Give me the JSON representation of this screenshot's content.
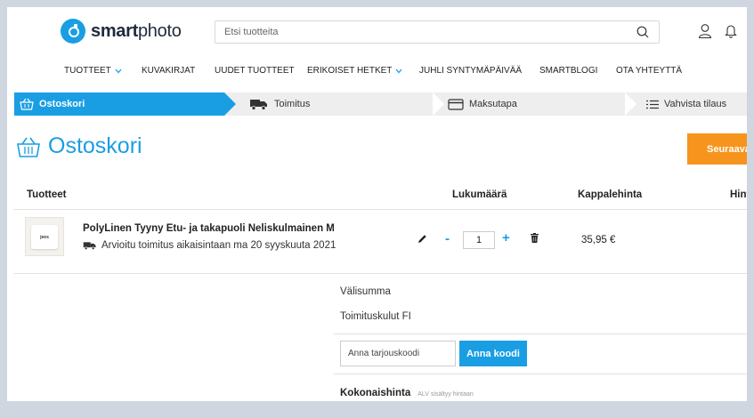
{
  "header": {
    "logo_bold": "smart",
    "logo_regular": "photo",
    "search_placeholder": "Etsi tuotteita"
  },
  "nav": {
    "items": [
      {
        "label": "TUOTTEET",
        "has_dropdown": true
      },
      {
        "label": "KUVAKIRJAT",
        "has_dropdown": false
      },
      {
        "label": "UUDET TUOTTEET",
        "has_dropdown": false
      },
      {
        "label": "ERIKOISET HETKET",
        "has_dropdown": true
      },
      {
        "label": "JUHLI SYNTYMÄPÄIVÄÄ",
        "has_dropdown": false
      },
      {
        "label": "SMARTBLOGI",
        "has_dropdown": false
      },
      {
        "label": "OTA YHTEYTTÄ",
        "has_dropdown": false
      }
    ]
  },
  "steps": [
    {
      "label": "Ostoskori",
      "icon": "basket-icon",
      "active": true
    },
    {
      "label": "Toimitus",
      "icon": "truck-icon",
      "active": false
    },
    {
      "label": "Maksutapa",
      "icon": "credit-card-icon",
      "active": false
    },
    {
      "label": "Vahvista tilaus",
      "icon": "list-icon",
      "active": false
    }
  ],
  "page": {
    "title": "Ostoskori",
    "next_button": "Seuraava"
  },
  "table": {
    "headers": [
      "Tuotteet",
      "Lukumäärä",
      "Kappalehinta",
      "Hint"
    ]
  },
  "cart": {
    "items": [
      {
        "thumb_text": "jees",
        "name": "PolyLinen Tyyny Etu- ja takapuoli Neliskulmainen M",
        "delivery": "Arvioitu toimitus aikaisintaan ma 20 syyskuuta 2021",
        "quantity": "1",
        "unit_price": "35,95 €"
      }
    ]
  },
  "summary": {
    "subtotal_label": "Välisumma",
    "shipping_label": "Toimituskulut FI",
    "promo_placeholder": "Anna tarjouskoodi",
    "promo_button": "Anna koodi",
    "total_label": "Kokonaishinta",
    "vat_note": "ALV sisältyy hintaan"
  },
  "colors": {
    "accent": "#1a9ee3",
    "cta": "#f7941d",
    "background": "#cfd6df"
  }
}
